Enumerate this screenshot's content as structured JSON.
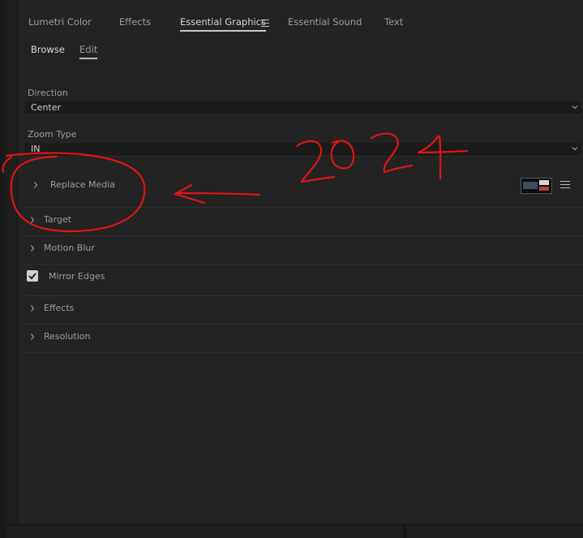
{
  "tabs": [
    {
      "label": "Lumetri Color"
    },
    {
      "label": "Effects"
    },
    {
      "label": "Essential Graphics"
    },
    {
      "label": "Essential Sound"
    },
    {
      "label": "Text"
    }
  ],
  "subtabs": [
    {
      "label": "Browse"
    },
    {
      "label": "Edit"
    }
  ],
  "direction": {
    "label": "Direction",
    "value": "Center"
  },
  "zoom_type": {
    "label": "Zoom Type",
    "value": "IN"
  },
  "sections": [
    {
      "label": "Replace Media"
    },
    {
      "label": "Target"
    },
    {
      "label": "Motion Blur"
    },
    {
      "label": "Mirror Edges",
      "checked": true
    },
    {
      "label": "Effects"
    },
    {
      "label": "Resolution"
    }
  ],
  "annotation": {
    "text": "2024",
    "color": "#e01414"
  }
}
